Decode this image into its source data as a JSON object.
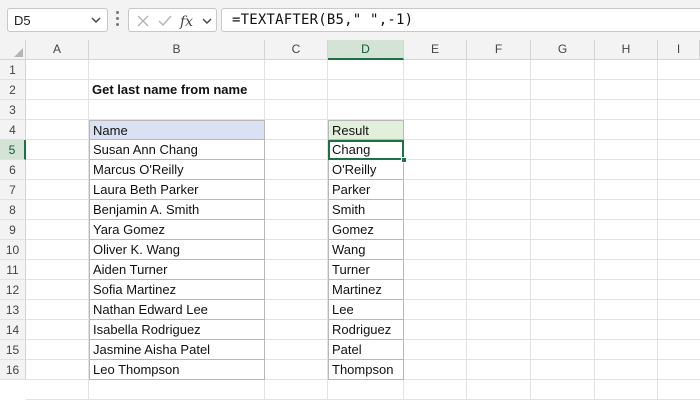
{
  "name_box": {
    "value": "D5"
  },
  "formula_bar": {
    "formula": "=TEXTAFTER(B5,\" \",-1)"
  },
  "columns": [
    "A",
    "B",
    "C",
    "D",
    "E",
    "F",
    "G",
    "H",
    "I"
  ],
  "active_column": "D",
  "rows": [
    "1",
    "2",
    "3",
    "4",
    "5",
    "6",
    "7",
    "8",
    "9",
    "10",
    "11",
    "12",
    "13",
    "14",
    "15",
    "16"
  ],
  "active_row": "5",
  "sheet": {
    "title": "Get last name from name",
    "name_header": "Name",
    "result_header": "Result",
    "names": [
      "Susan Ann Chang",
      "Marcus O'Reilly",
      "Laura Beth Parker",
      "Benjamin A. Smith",
      "Yara Gomez",
      "Oliver K. Wang",
      "Aiden Turner",
      "Sofia Martinez",
      "Nathan Edward Lee",
      "Isabella Rodriguez",
      "Jasmine Aisha Patel",
      "Leo Thompson"
    ],
    "results": [
      "Chang",
      "O'Reilly",
      "Parker",
      "Smith",
      "Gomez",
      "Wang",
      "Turner",
      "Martinez",
      "Lee",
      "Rodriguez",
      "Patel",
      "Thompson"
    ]
  },
  "icons": {
    "name_box_dropdown": "chevron-down-icon",
    "cancel": "x-icon",
    "enter": "check-icon",
    "function": "fx-icon",
    "function_dropdown": "chevron-down-icon",
    "select_all": "select-all-triangle-icon"
  },
  "colors": {
    "selection": "#1e7145",
    "name_header_fill": "#d9e1f2",
    "result_header_fill": "#e2efda"
  }
}
